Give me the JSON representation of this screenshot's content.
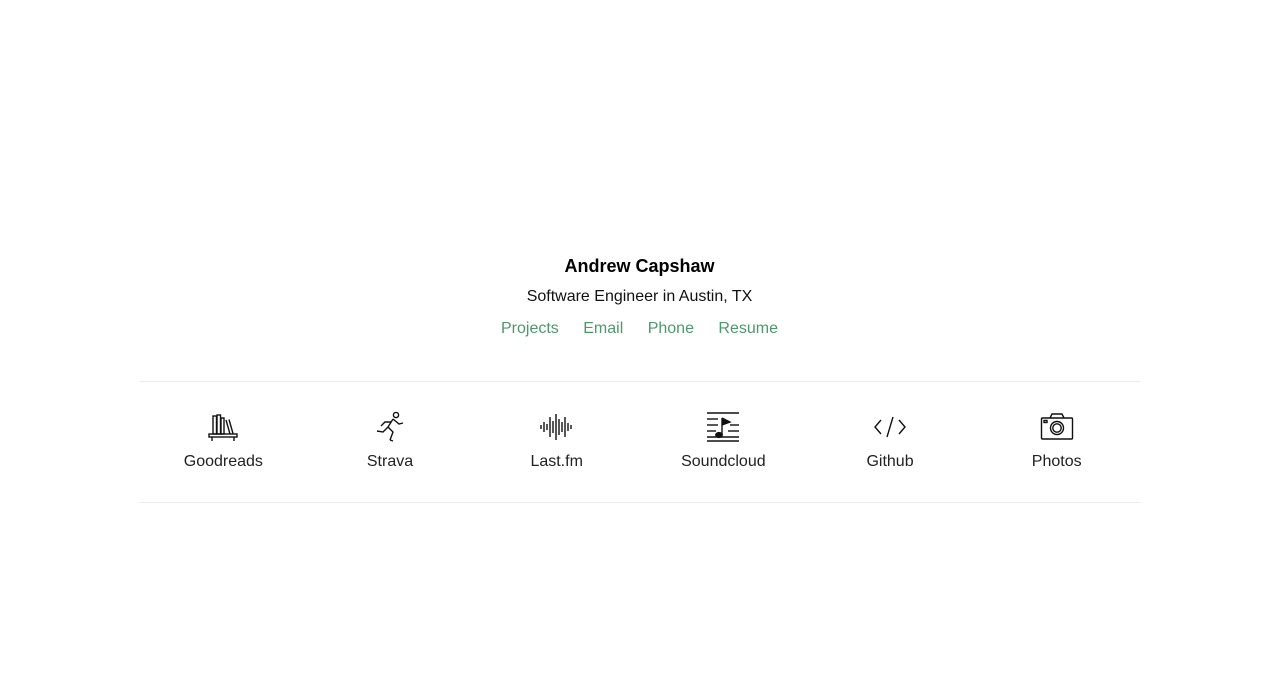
{
  "profile": {
    "name": "Andrew Capshaw",
    "tagline": "Software Engineer in Austin, TX"
  },
  "links": [
    {
      "label": "Projects"
    },
    {
      "label": "Email"
    },
    {
      "label": "Phone"
    },
    {
      "label": "Resume"
    }
  ],
  "services": [
    {
      "label": "Goodreads",
      "icon": "bookshelf-icon"
    },
    {
      "label": "Strava",
      "icon": "runner-icon"
    },
    {
      "label": "Last.fm",
      "icon": "sound-wave-icon"
    },
    {
      "label": "Soundcloud",
      "icon": "music-note-icon"
    },
    {
      "label": "Github",
      "icon": "code-icon"
    },
    {
      "label": "Photos",
      "icon": "camera-icon"
    }
  ],
  "colors": {
    "link": "#4c9a6b",
    "divider": "#ececec"
  }
}
